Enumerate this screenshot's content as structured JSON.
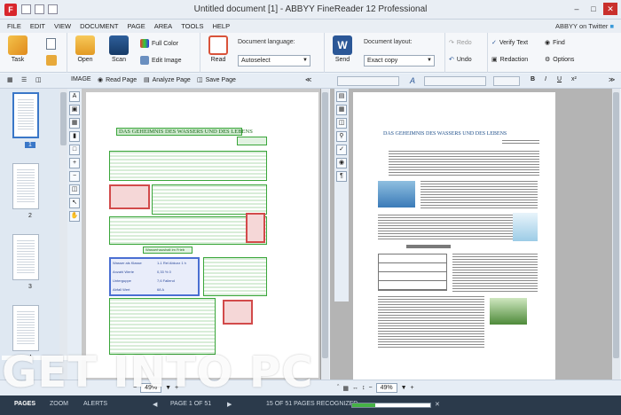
{
  "titlebar": {
    "logo_letter": "F",
    "title": "Untitled document [1] - ABBYY FineReader 12 Professional",
    "minimize": "–",
    "maximize": "□",
    "close": "✕"
  },
  "menu": {
    "items": [
      "FILE",
      "EDIT",
      "VIEW",
      "DOCUMENT",
      "PAGE",
      "AREA",
      "TOOLS",
      "HELP"
    ],
    "twitter": "ABBYY on Twitter"
  },
  "ribbon": {
    "task": "Task",
    "open": "Open",
    "scan": "Scan",
    "full_color": "Full Color",
    "edit_image": "Edit Image",
    "read": "Read",
    "doc_language_label": "Document language:",
    "doc_language_value": "Autoselect",
    "send": "Send",
    "doc_layout_label": "Document layout:",
    "doc_layout_value": "Exact copy",
    "redo": "Redo",
    "undo": "Undo",
    "verify_text": "Verify Text",
    "redaction": "Redaction",
    "find": "Find",
    "options": "Options"
  },
  "image_toolbar": {
    "image_label": "IMAGE",
    "read_page": "Read Page",
    "analyze_page": "Analyze Page",
    "save_page": "Save Page"
  },
  "thumbnails": {
    "pages": [
      "1",
      "2",
      "3",
      "4"
    ],
    "selected": "1"
  },
  "document": {
    "heading": "DAS GEHEIMNIS DES WASSERS UND DES LEBENS",
    "table_caption": "Wasserhaushalt im Frieb",
    "table_rows": [
      [
        "Wasser als Klasse",
        "1-1 Rel Abkurz 1 h"
      ],
      [
        "Anzahl Werte",
        "0,33 % 0"
      ],
      [
        "Unterguppe",
        "7,6 Fallend"
      ],
      [
        "Abfall Wert",
        "68 A"
      ]
    ]
  },
  "zoom": {
    "left_value": "49%",
    "right_value": "49%"
  },
  "status": {
    "pages": "PAGES",
    "zoom": "ZOOM",
    "alerts": "ALERTS",
    "page_of": "PAGE 1 OF 51",
    "recognized": "15 OF 51 PAGES RECOGNIZED",
    "progress": 0.29
  },
  "watermark": "GET INTO PC",
  "colors": {
    "accent": "#3a77c8",
    "status_bg": "#2b3a4b",
    "zone_text": "#3aa63a",
    "zone_picture": "#d24a4a",
    "zone_table": "#4a6fd2",
    "progress": "#45b245"
  }
}
